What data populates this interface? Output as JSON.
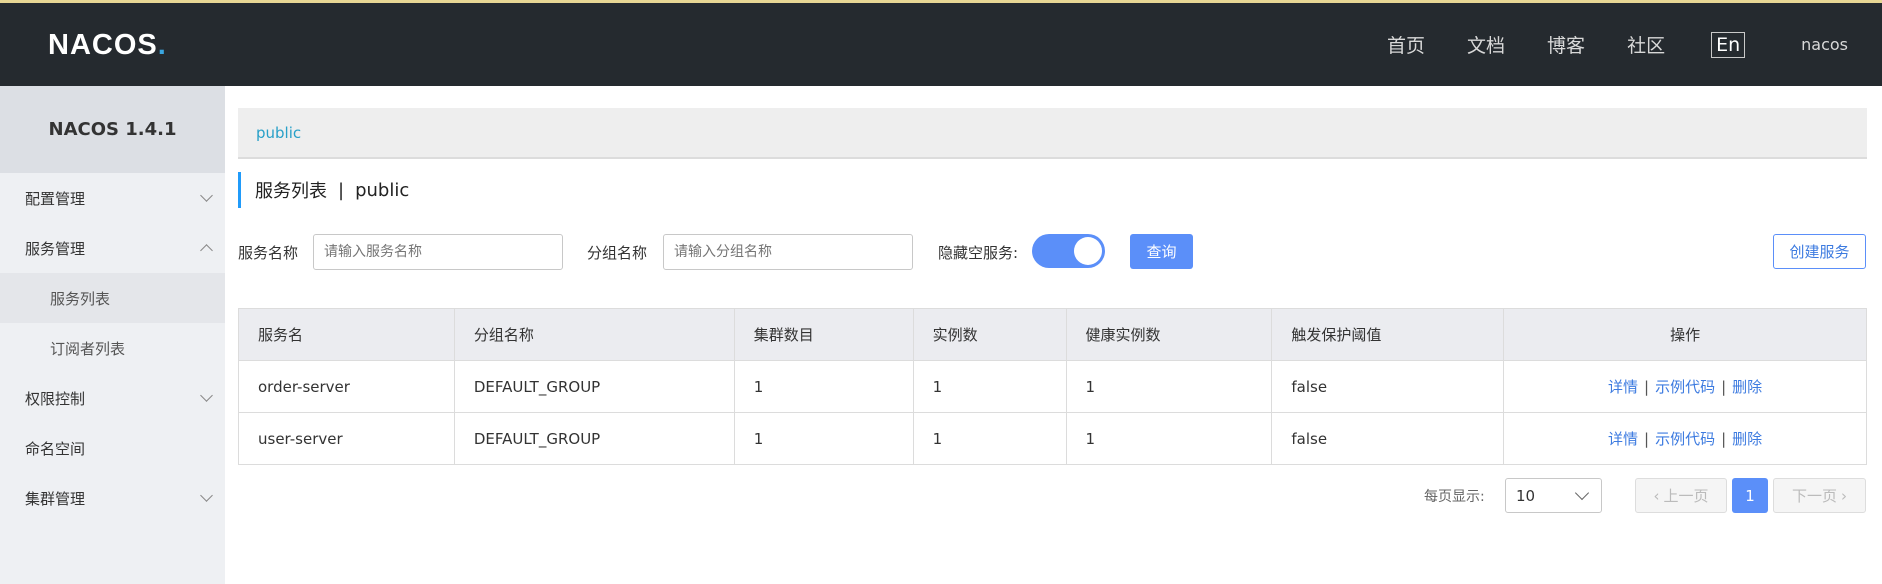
{
  "header": {
    "logo": "NACOS",
    "nav": [
      "首页",
      "文档",
      "博客",
      "社区"
    ],
    "lang": "En",
    "user": "nacos"
  },
  "sidebar": {
    "version": "NACOS 1.4.1",
    "items": [
      {
        "label": "配置管理",
        "icon": "chevron-down-icon"
      },
      {
        "label": "服务管理",
        "icon": "chevron-up-icon",
        "expanded": true
      },
      {
        "label": "服务列表",
        "sub": true,
        "active": true
      },
      {
        "label": "订阅者列表",
        "sub": true
      },
      {
        "label": "权限控制",
        "icon": "chevron-down-icon"
      },
      {
        "label": "命名空间"
      },
      {
        "label": "集群管理",
        "icon": "chevron-down-icon"
      }
    ]
  },
  "namespace_bar": {
    "current": "public"
  },
  "page_title": {
    "title": "服务列表",
    "separator": "|",
    "namespace": "public"
  },
  "filters": {
    "service_name_label": "服务名称",
    "service_name_placeholder": "请输入服务名称",
    "group_name_label": "分组名称",
    "group_name_placeholder": "请输入分组名称",
    "hide_empty_label": "隐藏空服务:",
    "hide_empty_on": true,
    "query_label": "查询",
    "create_label": "创建服务"
  },
  "table": {
    "columns": [
      "服务名",
      "分组名称",
      "集群数目",
      "实例数",
      "健康实例数",
      "触发保护阈值",
      "操作"
    ],
    "rows": [
      {
        "name": "order-server",
        "group": "DEFAULT_GROUP",
        "clusters": "1",
        "instances": "1",
        "healthy": "1",
        "threshold": "false"
      },
      {
        "name": "user-server",
        "group": "DEFAULT_GROUP",
        "clusters": "1",
        "instances": "1",
        "healthy": "1",
        "threshold": "false"
      }
    ],
    "ops": {
      "detail": "详情",
      "sample": "示例代码",
      "delete": "删除",
      "sep": "|"
    }
  },
  "pagination": {
    "per_page_label": "每页显示:",
    "per_page": "10",
    "prev": "上一页",
    "current": "1",
    "next": "下一页"
  },
  "colors": {
    "accent": "#5b8ff9",
    "header_bg": "#252a2f",
    "sidebar_bg": "#eef0f3",
    "link": "#3d7be0"
  }
}
